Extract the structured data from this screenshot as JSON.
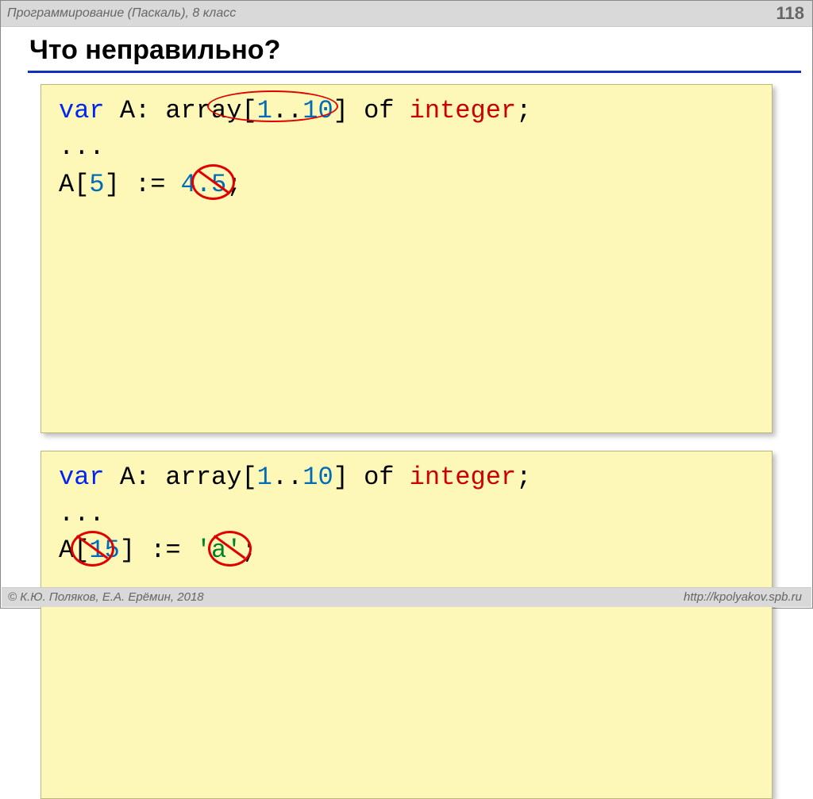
{
  "header": {
    "course": "Программирование (Паскаль), 8 класс",
    "page_number": "118"
  },
  "title": "Что неправильно?",
  "code1": {
    "l1_var": "var",
    "l1_mid": " A: array[",
    "l1_from": "1",
    "l1_dots": "..",
    "l1_to": "10",
    "l1_after": "] of ",
    "l1_type": "integer",
    "l1_semi": ";",
    "l2_dots": "...",
    "l3_a": "A[",
    "l3_idx": "5",
    "l3_b": "] := ",
    "l3_val": "4.5",
    "l3_c": ";"
  },
  "code2": {
    "l1_var": "var",
    "l1_mid": " A: array[",
    "l1_from": "1",
    "l1_dots": "..",
    "l1_to": "10",
    "l1_after": "] of ",
    "l1_type": "integer",
    "l1_semi": ";",
    "l2_dots": "...",
    "l3_a": "A[",
    "l3_idx": "15",
    "l3_b": "] := ",
    "l3_q1": "'",
    "l3_val": "a",
    "l3_q2": "'",
    "l3_c": ";"
  },
  "footer": {
    "copyright": "© К.Ю. Поляков, Е.А. Ерёмин, 2018",
    "url": "http://kpolyakov.spb.ru"
  }
}
